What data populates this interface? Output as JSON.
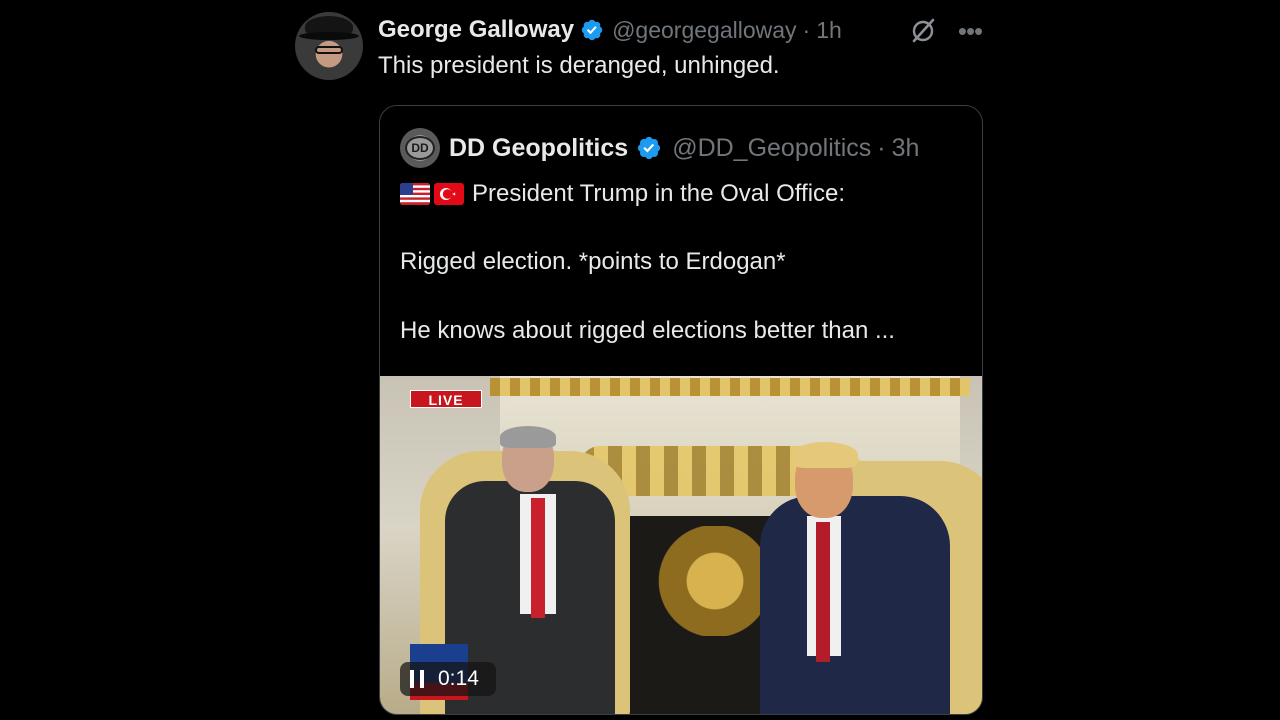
{
  "tweet": {
    "author_name": "George Galloway",
    "author_handle": "@georgegalloway",
    "separator": "·",
    "time": "1h",
    "text": "This president is deranged, unhinged.",
    "more_icon": "•••"
  },
  "quote": {
    "author_name": "DD Geopolitics",
    "author_handle": "@DD_Geopolitics",
    "separator": "·",
    "time": "3h",
    "avatar_text": "DD",
    "line1": "President Trump in the Oval Office:",
    "line2": "Rigged election. *points to Erdogan*",
    "line3": "He knows about rigged elections better than ...",
    "flags": [
      "us-flag",
      "turkey-flag"
    ]
  },
  "video": {
    "live_label": "LIVE",
    "duration": "0:14",
    "state": "playing"
  },
  "colors": {
    "background": "#000000",
    "text_primary": "#e7e9ea",
    "text_secondary": "#71767b",
    "verified_blue": "#1d9bf0",
    "border": "#3a3f44"
  }
}
